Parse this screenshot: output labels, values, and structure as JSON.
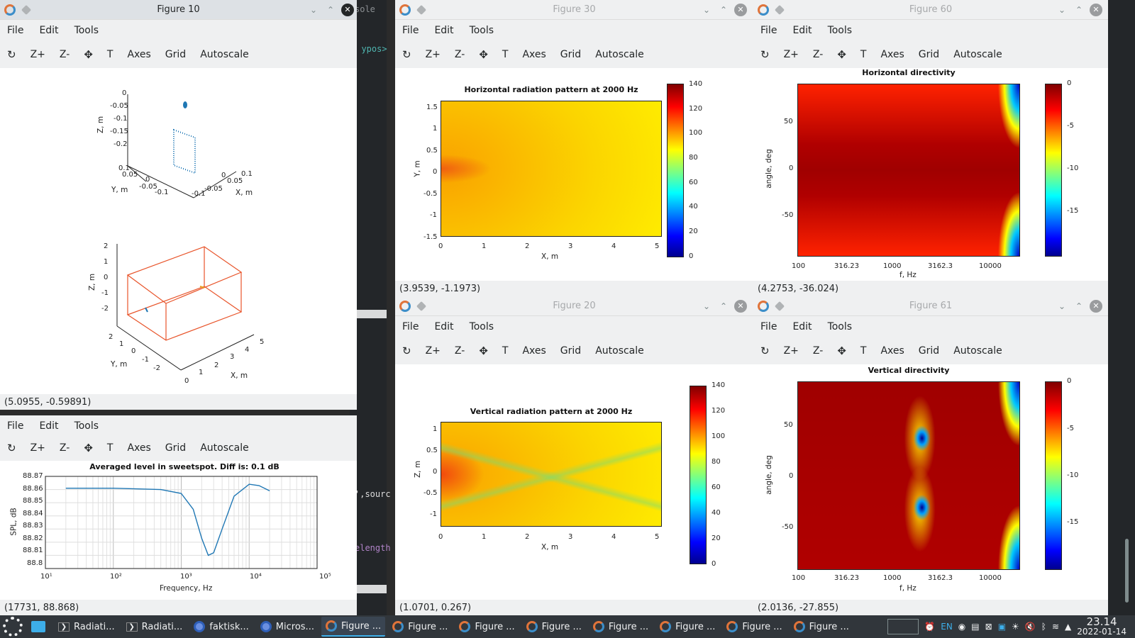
{
  "background": {
    "console_fragment": "sole",
    "code_fragments": [
      "s ypos>",
      "',sourc",
      "elength"
    ]
  },
  "menu": [
    "File",
    "Edit",
    "Tools"
  ],
  "toolbar": {
    "zplus": "Z+",
    "zminus": "Z-",
    "text": "T",
    "axes": "Axes",
    "grid": "Grid",
    "autoscale": "Autoscale"
  },
  "windows": {
    "fig10": {
      "title": "Figure 10",
      "plot_top": {
        "zlabel": "Z, m",
        "ylabel": "Y, m",
        "xlabel": "X, m",
        "zticks": [
          "0",
          "-0.05",
          "-0.1",
          "-0.15",
          "-0.2"
        ],
        "yticks": [
          "0.1",
          "0.05",
          "0",
          "-0.05",
          "-0.1"
        ],
        "xticks": [
          "-0.1",
          "-0.05",
          "0",
          "0.05",
          "0.1"
        ]
      },
      "plot_mid": {
        "zlabel": "Z, m",
        "ylabel": "Y, m",
        "xlabel": "X, m",
        "zticks": [
          "2",
          "1",
          "0",
          "-1",
          "-2"
        ],
        "yticks": [
          "2",
          "1",
          "0",
          "-1",
          "-2"
        ],
        "xticks": [
          "0",
          "1",
          "2",
          "3",
          "4",
          "5"
        ]
      },
      "status": "(5.0955, -0.59891)"
    },
    "fig_avg": {
      "chart_data": {
        "type": "line",
        "title": "Averaged level in sweetspot. Diff is: 0.1 dB",
        "xlabel": "Frequency, Hz",
        "ylabel": "SPL, dB",
        "xscale": "log",
        "xlim": [
          10,
          100000
        ],
        "ylim": [
          88.8,
          88.87
        ],
        "xticks": [
          "10¹",
          "10²",
          "10³",
          "10⁴",
          "10⁵"
        ],
        "yticks": [
          "88.87",
          "88.86",
          "88.85",
          "88.84",
          "88.83",
          "88.82",
          "88.81",
          "88.8"
        ],
        "grid": true,
        "series": [
          {
            "x": [
              20,
              100,
              500,
              1000,
              1500,
              2000,
              2500,
              3000,
              4000,
              6000,
              10000,
              14000,
              20000
            ],
            "y": [
              88.861,
              88.861,
              88.86,
              88.857,
              88.845,
              88.823,
              88.81,
              88.812,
              88.83,
              88.855,
              88.864,
              88.863,
              88.859
            ]
          }
        ]
      },
      "status": "(17731, 88.868)"
    },
    "fig30": {
      "title": "Figure 30",
      "chart_data": {
        "type": "heatmap",
        "title": "Horizontal radiation pattern at 2000 Hz",
        "xlabel": "X, m",
        "ylabel": "Y, m",
        "xticks": [
          "0",
          "1",
          "2",
          "3",
          "4",
          "5"
        ],
        "yticks": [
          "1.5",
          "1",
          "0.5",
          "0",
          "-0.5",
          "-1",
          "-1.5"
        ],
        "colorbar": [
          "140",
          "120",
          "100",
          "80",
          "60",
          "40",
          "20",
          "0"
        ]
      },
      "status": "(3.9539, -1.1973)"
    },
    "fig20": {
      "title": "Figure 20",
      "chart_data": {
        "type": "heatmap",
        "title": "Vertical radiation pattern at 2000 Hz",
        "xlabel": "X, m",
        "ylabel": "Z, m",
        "xticks": [
          "0",
          "1",
          "2",
          "3",
          "4",
          "5"
        ],
        "yticks": [
          "1",
          "0.5",
          "0",
          "-0.5",
          "-1"
        ],
        "colorbar": [
          "140",
          "120",
          "100",
          "80",
          "60",
          "40",
          "20",
          "0"
        ]
      },
      "status": "(1.0701, 0.267)"
    },
    "fig60": {
      "title": "Figure 60",
      "chart_data": {
        "type": "heatmap",
        "title": "Horizontal directivity",
        "xlabel": "f, Hz",
        "ylabel": "angle, deg",
        "xticks": [
          "100",
          "316.23",
          "1000",
          "3162.3",
          "10000"
        ],
        "yticks": [
          "50",
          "0",
          "-50"
        ],
        "colorbar": [
          "0",
          "-5",
          "-10",
          "-15"
        ]
      },
      "status": "(4.2753, -36.024)"
    },
    "fig61": {
      "title": "Figure 61",
      "chart_data": {
        "type": "heatmap",
        "title": "Vertical directivity",
        "xlabel": "f, Hz",
        "ylabel": "angle, deg",
        "xticks": [
          "100",
          "316.23",
          "1000",
          "3162.3",
          "10000"
        ],
        "yticks": [
          "50",
          "0",
          "-50"
        ],
        "colorbar": [
          "0",
          "-5",
          "-10",
          "-15"
        ]
      },
      "status": "(2.0136, -27.855)"
    }
  },
  "taskbar": {
    "items": [
      "Radiati...",
      "Radiati...",
      "faktisk...",
      "Micros...",
      "Figure ...",
      "Figure ...",
      "Figure ...",
      "Figure ...",
      "Figure ...",
      "Figure ...",
      "Figure ...",
      "Figure ..."
    ],
    "lang": "EN",
    "time": "23.14",
    "date": "2022-01-14"
  }
}
